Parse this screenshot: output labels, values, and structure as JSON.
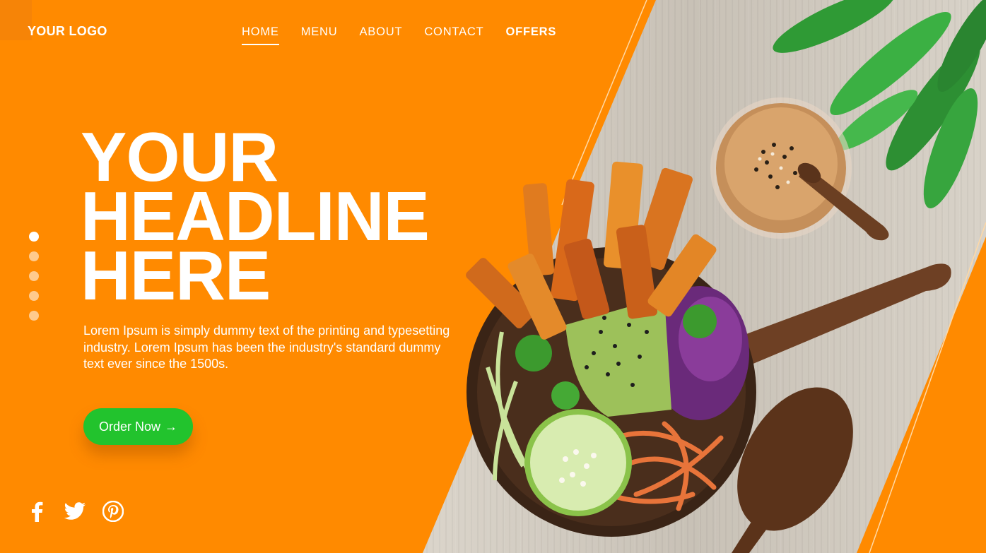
{
  "brand": {
    "logo": "YOUR LOGO"
  },
  "nav": {
    "items": [
      {
        "label": "HOME",
        "active": true
      },
      {
        "label": "MENU"
      },
      {
        "label": "ABOUT"
      },
      {
        "label": "CONTACT"
      },
      {
        "label": "OFFERS"
      }
    ]
  },
  "hero": {
    "headline_lines": [
      "YOUR",
      "HEADLINE",
      "HERE"
    ],
    "body": "Lorem Ipsum is simply dummy text of the printing and typesetting industry. Lorem Ipsum has been the industry's standard dummy text ever since the 1500s.",
    "cta_label": "Order Now",
    "cta_arrow": "→"
  },
  "pager": {
    "count": 5,
    "active_index": 0
  },
  "social": {
    "icons": [
      "facebook-icon",
      "twitter-icon",
      "pinterest-icon"
    ]
  },
  "colors": {
    "orange": "#ff8a00",
    "green": "#22c32d",
    "white": "#ffffff"
  }
}
